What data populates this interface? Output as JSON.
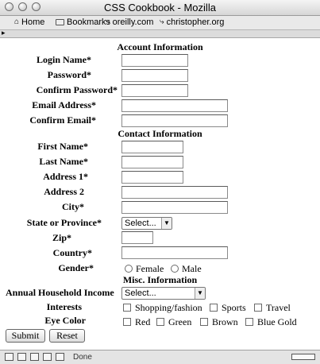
{
  "window": {
    "title": "CSS Cookbook - Mozilla"
  },
  "bookmarks": {
    "items": [
      {
        "label": "Home",
        "icon": "home-icon"
      },
      {
        "label": "Bookmarks",
        "icon": "folder-icon"
      },
      {
        "label": "oreilly.com",
        "icon": "bookmark-icon"
      },
      {
        "label": "christopher.org",
        "icon": "bookmark-icon"
      }
    ]
  },
  "form": {
    "sections": {
      "account": "Account Information",
      "contact": "Contact Information",
      "misc": "Misc. Information"
    },
    "labels": {
      "login_name": "Login Name*",
      "password": "Password*",
      "confirm_password": "Confirm Password*",
      "email": "Email Address*",
      "confirm_email": "Confirm Email*",
      "first_name": "First Name*",
      "last_name": "Last Name*",
      "address1": "Address 1*",
      "address2": "Address 2",
      "city": "City*",
      "state": "State or Province*",
      "zip": "Zip*",
      "country": "Country*",
      "gender": "Gender*",
      "income": "Annual Household Income",
      "interests": "Interests",
      "eye_color": "Eye Color"
    },
    "values": {
      "login_name": "",
      "password": "",
      "confirm_password": "",
      "email": "",
      "confirm_email": "",
      "first_name": "",
      "last_name": "",
      "address1": "",
      "address2": "",
      "city": "",
      "zip": "",
      "country": ""
    },
    "state_select": "Select...",
    "income_select": "Select...",
    "gender_options": [
      "Female",
      "Male"
    ],
    "interest_options": [
      "Shopping/fashion",
      "Sports",
      "Travel"
    ],
    "eye_color_options": [
      "Red",
      "Green",
      "Brown",
      "Blue Gold"
    ],
    "buttons": {
      "submit": "Submit",
      "reset": "Reset"
    }
  },
  "statusbar": {
    "text": "Done"
  }
}
